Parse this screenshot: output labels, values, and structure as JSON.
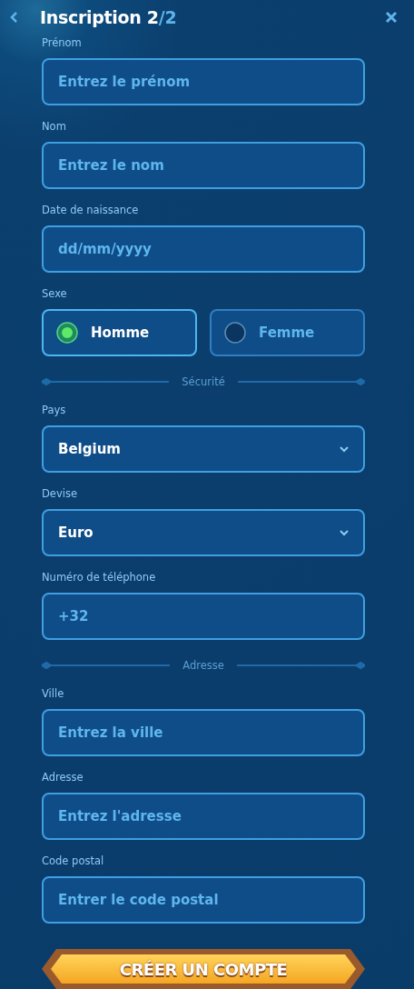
{
  "header": {
    "title": "Inscription 2",
    "title_suffix": "/2"
  },
  "form": [
    {
      "kind": "text",
      "label": "Prénom",
      "placeholder": "Entrez le prénom"
    },
    {
      "kind": "text",
      "label": "Nom",
      "placeholder": "Entrez le nom"
    },
    {
      "kind": "text",
      "label": "Date de naissance",
      "placeholder": "dd/mm/yyyy"
    },
    {
      "kind": "radio",
      "label": "Sexe",
      "options": [
        {
          "label": "Homme",
          "selected": true
        },
        {
          "label": "Femme",
          "selected": false
        }
      ]
    },
    {
      "kind": "divider",
      "label": "Sécurité"
    },
    {
      "kind": "select",
      "label": "Pays",
      "value": "Belgium"
    },
    {
      "kind": "select",
      "label": "Devise",
      "value": "Euro"
    },
    {
      "kind": "text",
      "label": "Numéro de téléphone",
      "placeholder": "+32"
    },
    {
      "kind": "divider",
      "label": "Adresse"
    },
    {
      "kind": "text",
      "label": "Ville",
      "placeholder": "Entrez la ville"
    },
    {
      "kind": "text",
      "label": "Adresse",
      "placeholder": "Entrez l'adresse"
    },
    {
      "kind": "text",
      "label": "Code postal",
      "placeholder": "Entrer le code postal"
    }
  ],
  "submit_button": "CRÉER UN COMPTE"
}
